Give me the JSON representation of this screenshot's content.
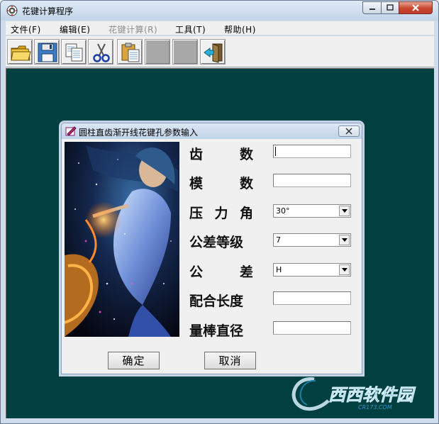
{
  "window": {
    "title": "花键计算程序"
  },
  "menu": [
    {
      "label": "文件(F)",
      "enabled": true
    },
    {
      "label": "编辑(E)",
      "enabled": true
    },
    {
      "label": "花键计算(R)",
      "enabled": false
    },
    {
      "label": "工具(T)",
      "enabled": true
    },
    {
      "label": "帮助(H)",
      "enabled": true
    }
  ],
  "toolbar": [
    {
      "icon": "open-folder-icon"
    },
    {
      "icon": "save-icon"
    },
    {
      "icon": "copy-icon"
    },
    {
      "icon": "cut-icon"
    },
    {
      "icon": "paste-icon"
    },
    {
      "icon": "blank"
    },
    {
      "icon": "blank"
    },
    {
      "icon": "exit-icon"
    }
  ],
  "colors": {
    "client_background": "#004040",
    "titlebar": "#c8d8ec",
    "close_button": "#c9462c"
  },
  "dialog": {
    "title": "圆柱直齿渐开线花键孔参数输入",
    "fields": [
      {
        "label_chars": [
          "齿",
          "数"
        ],
        "type": "text",
        "value": ""
      },
      {
        "label_chars": [
          "模",
          "数"
        ],
        "type": "text",
        "value": ""
      },
      {
        "label_chars": [
          "压",
          "力",
          "角"
        ],
        "type": "select",
        "value": "30°"
      },
      {
        "label_chars": [
          "公差等级"
        ],
        "type": "select",
        "value": "7"
      },
      {
        "label_chars": [
          "公",
          "差"
        ],
        "type": "select",
        "value": "H"
      },
      {
        "label_chars": [
          "配合长度"
        ],
        "type": "text",
        "value": ""
      },
      {
        "label_chars": [
          "量棒直径"
        ],
        "type": "text",
        "value": ""
      }
    ],
    "ok_label": "确定",
    "cancel_label": "取消"
  },
  "watermark": {
    "brand": "西西软件园",
    "domain": "CR173.COM"
  }
}
